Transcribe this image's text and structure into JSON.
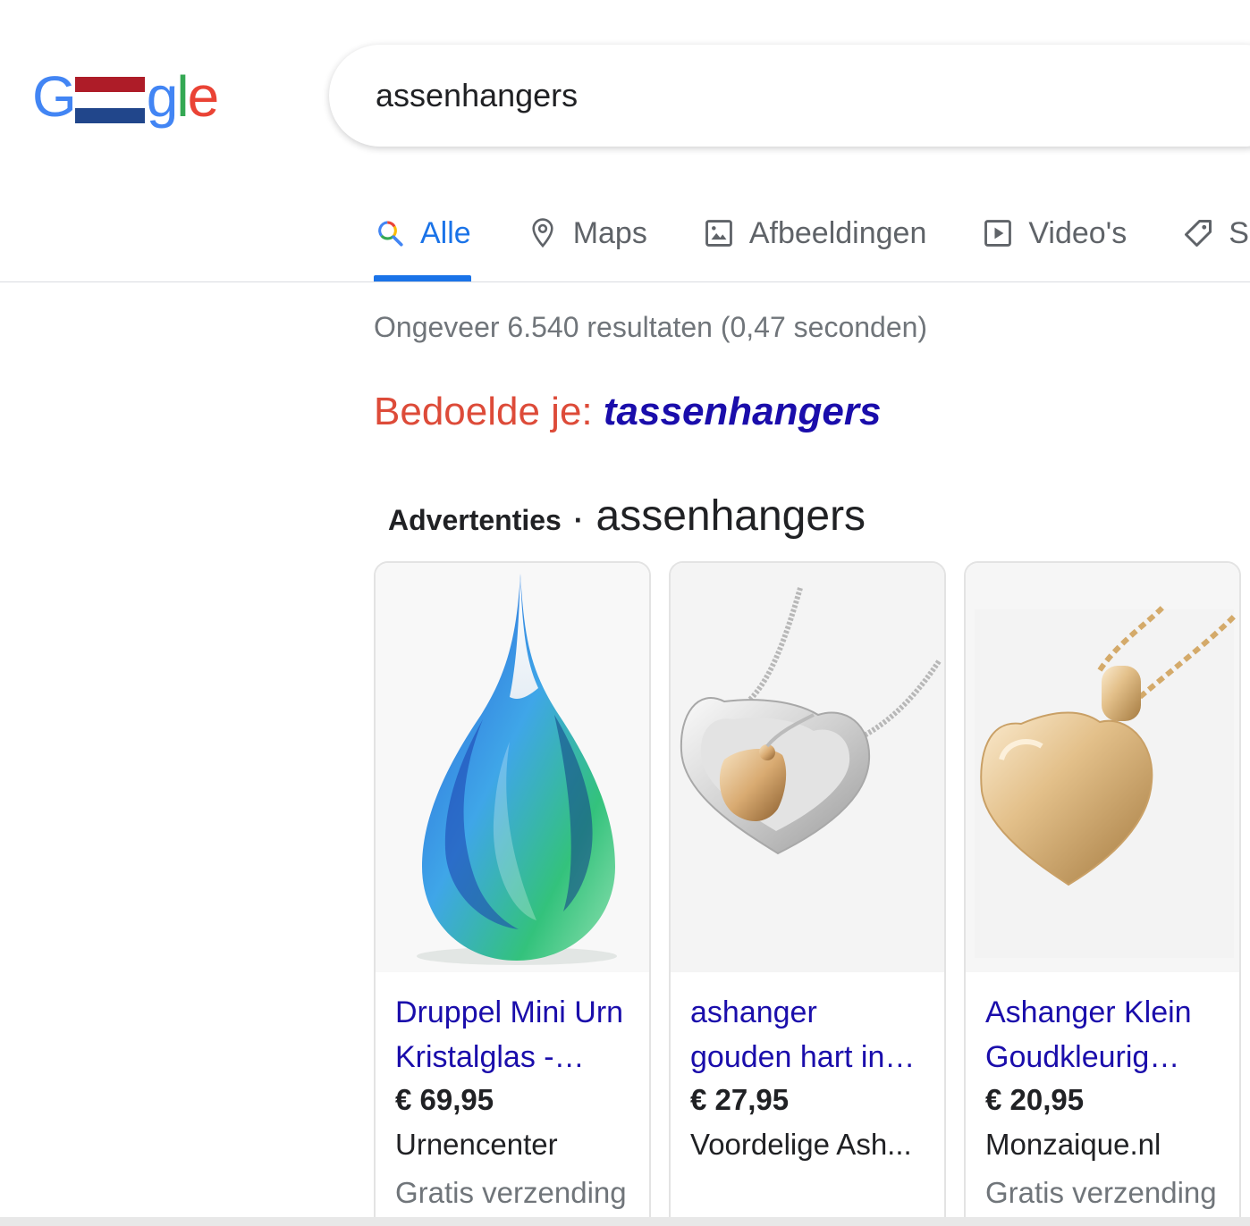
{
  "logo": {
    "first_letter": "G",
    "rest": {
      "g": "g",
      "l": "l",
      "e": "e"
    },
    "flag_colors": [
      "#ae1c28",
      "#ffffff",
      "#21468b"
    ]
  },
  "search": {
    "query": "assenhangers"
  },
  "tabs": [
    {
      "label": "Alle",
      "icon": "google-search-icon",
      "active": true
    },
    {
      "label": "Maps",
      "icon": "map-pin-icon",
      "active": false
    },
    {
      "label": "Afbeeldingen",
      "icon": "image-icon",
      "active": false
    },
    {
      "label": "Video's",
      "icon": "video-play-icon",
      "active": false
    },
    {
      "label": "S",
      "icon": "tag-icon",
      "active": false
    }
  ],
  "result_stats": "Ongeveer 6.540 resultaten (0,47 seconden)",
  "did_you_mean": {
    "prefix": "Bedoelde je:",
    "suggestion": "tassenhangers"
  },
  "ads": {
    "label": "Advertenties",
    "separator": "·",
    "query": "assenhangers"
  },
  "products": [
    {
      "title_line1": "Druppel Mini Urn",
      "title_line2": "Kristalglas -…",
      "price": "€ 69,95",
      "shop": "Urnencenter",
      "shipping": "Gratis verzending",
      "image": "glass-drop-urn"
    },
    {
      "title_line1": "ashanger",
      "title_line2": "gouden hart in…",
      "price": "€ 27,95",
      "shop": "Voordelige Ash...",
      "shipping": "",
      "image": "heart-pendant-silver-gold"
    },
    {
      "title_line1": "Ashanger Klein",
      "title_line2": "Goudkleurig…",
      "price": "€ 20,95",
      "shop": "Monzaique.nl",
      "shipping": "Gratis verzending",
      "image": "gold-heart-pendant"
    }
  ],
  "colors": {
    "link": "#1a0dab",
    "active_tab": "#1a73e8",
    "did_you_mean_prefix": "#dd4b39",
    "muted": "#70757a"
  }
}
